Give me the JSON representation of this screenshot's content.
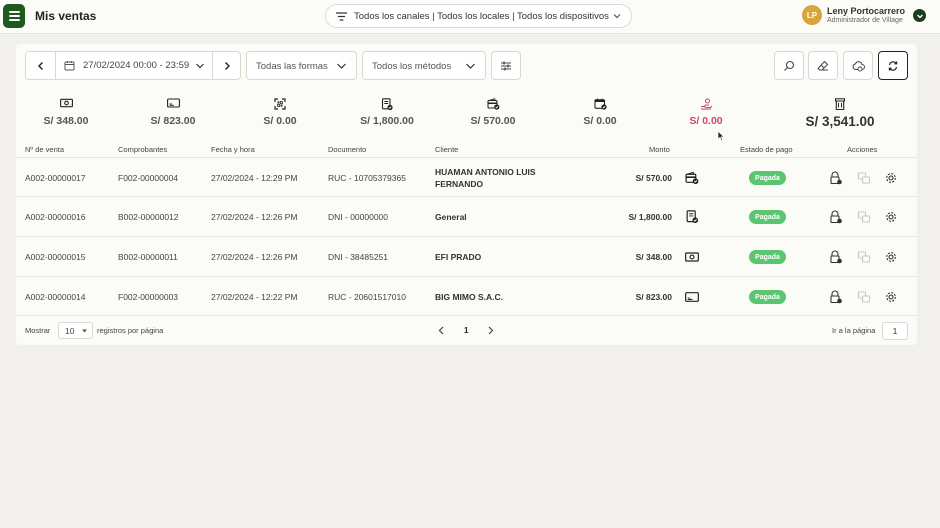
{
  "header": {
    "title": "Mis ventas",
    "channel_filter": "Todos los canales | Todos los locales | Todos los dispositivos",
    "user": {
      "initials": "LP",
      "name": "Leny Portocarrero",
      "role": "Administrador de Village"
    }
  },
  "filters": {
    "date_range": "27/02/2024 00:00 - 23:59",
    "forms": "Todas las formas",
    "methods": "Todos los métodos"
  },
  "summary": [
    {
      "icon": "cash-icon",
      "amount": "S/ 348.00"
    },
    {
      "icon": "card-icon",
      "amount": "S/ 823.00"
    },
    {
      "icon": "qr-icon",
      "amount": "S/ 0.00"
    },
    {
      "icon": "document-check-icon",
      "amount": "S/ 1,800.00"
    },
    {
      "icon": "wallet-check-icon",
      "amount": "S/ 570.00"
    },
    {
      "icon": "calendar-check-icon",
      "amount": "S/ 0.00"
    },
    {
      "icon": "hand-coins-icon",
      "amount": "S/ 0.00",
      "color": "#c8497a"
    },
    {
      "icon": "register-icon",
      "amount": "S/ 3,541.00"
    }
  ],
  "table": {
    "columns": [
      "Nº de venta",
      "Comprobantes",
      "Fecha y hora",
      "Documento",
      "Cliente",
      "Monto",
      "Estado de pago",
      "Acciones"
    ],
    "rows": [
      {
        "sale_no": "A002-00000017",
        "voucher": "F002-00000004",
        "datetime": "27/02/2024 - 12:29 PM",
        "document": "RUC - 10705379365",
        "client_line1": "HUAMAN ANTONIO LUIS",
        "client_line2": "FERNANDO",
        "amount": "S/ 570.00",
        "method_icon": "wallet-check-icon",
        "status": "Pagada"
      },
      {
        "sale_no": "A002-00000016",
        "voucher": "B002-00000012",
        "datetime": "27/02/2024 - 12:26 PM",
        "document": "DNI - 00000000",
        "client_line1": "General",
        "client_line2": "",
        "amount": "S/ 1,800.00",
        "method_icon": "document-check-icon",
        "status": "Pagada"
      },
      {
        "sale_no": "A002-00000015",
        "voucher": "B002-00000011",
        "datetime": "27/02/2024 - 12:26 PM",
        "document": "DNI - 38485251",
        "client_line1": "EFI PRADO",
        "client_line2": "",
        "amount": "S/ 348.00",
        "method_icon": "cash-icon",
        "status": "Pagada"
      },
      {
        "sale_no": "A002-00000014",
        "voucher": "F002-00000003",
        "datetime": "27/02/2024 - 12:22 PM",
        "document": "RUC - 20601517010",
        "client_line1": "BIG MIMO S.A.C.",
        "client_line2": "",
        "amount": "S/ 823.00",
        "method_icon": "card-icon",
        "status": "Pagada"
      }
    ]
  },
  "pagination": {
    "show_label": "Mostrar",
    "page_size": "10",
    "per_page_label": "registros por página",
    "current_page": "1",
    "goto_label": "Ir a la página",
    "goto_value": "1"
  },
  "colors": {
    "primary": "#1e5a1e",
    "paid": "#5cc56f",
    "pending_amount": "#c8497a",
    "avatar": "#d9a53a"
  }
}
